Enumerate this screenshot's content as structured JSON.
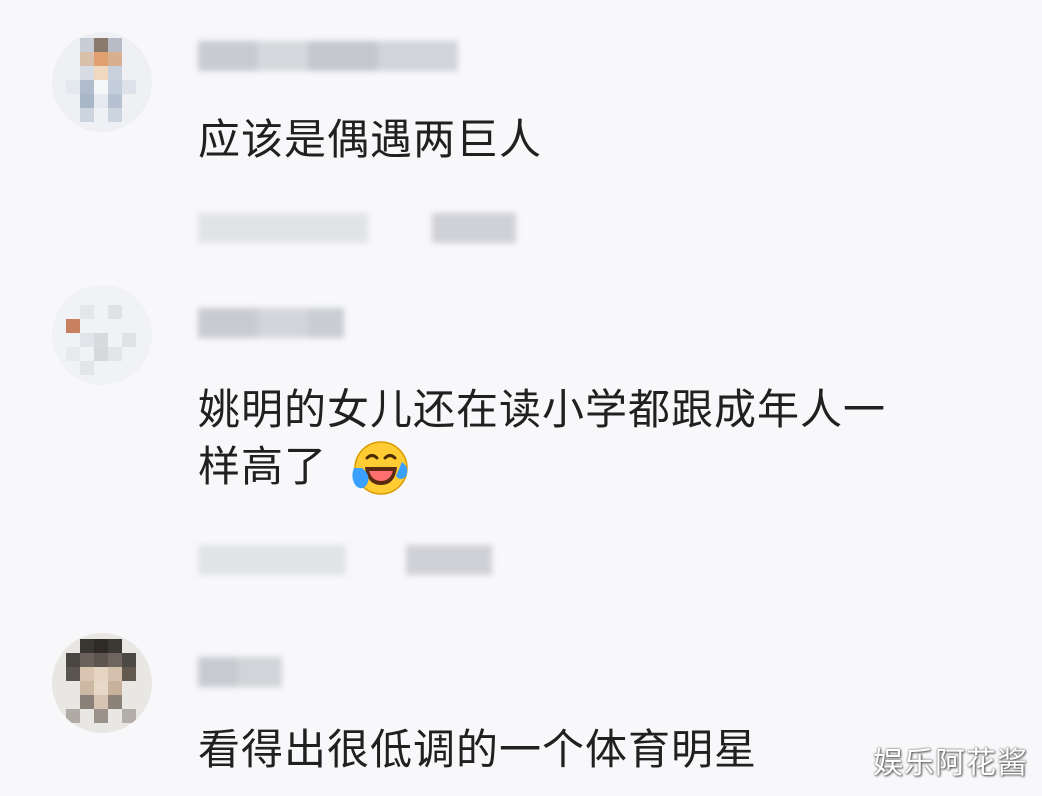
{
  "comments": [
    {
      "text": "应该是偶遇两巨人",
      "avatar_icon": "user-avatar-icon"
    },
    {
      "text_line1": "姚明的女儿还在读小学都跟成年人一",
      "text_line2": "样高了",
      "emoji": "laughing-crying-emoji",
      "avatar_icon": "user-avatar-icon"
    },
    {
      "text": "看得出很低调的一个体育明星",
      "avatar_icon": "user-avatar-icon"
    }
  ],
  "watermark": "娱乐阿花酱",
  "colors": {
    "text": "#202020",
    "background": "#f8f8fa",
    "emoji_face": "#ffcc33",
    "tear": "#3aa0ff"
  }
}
